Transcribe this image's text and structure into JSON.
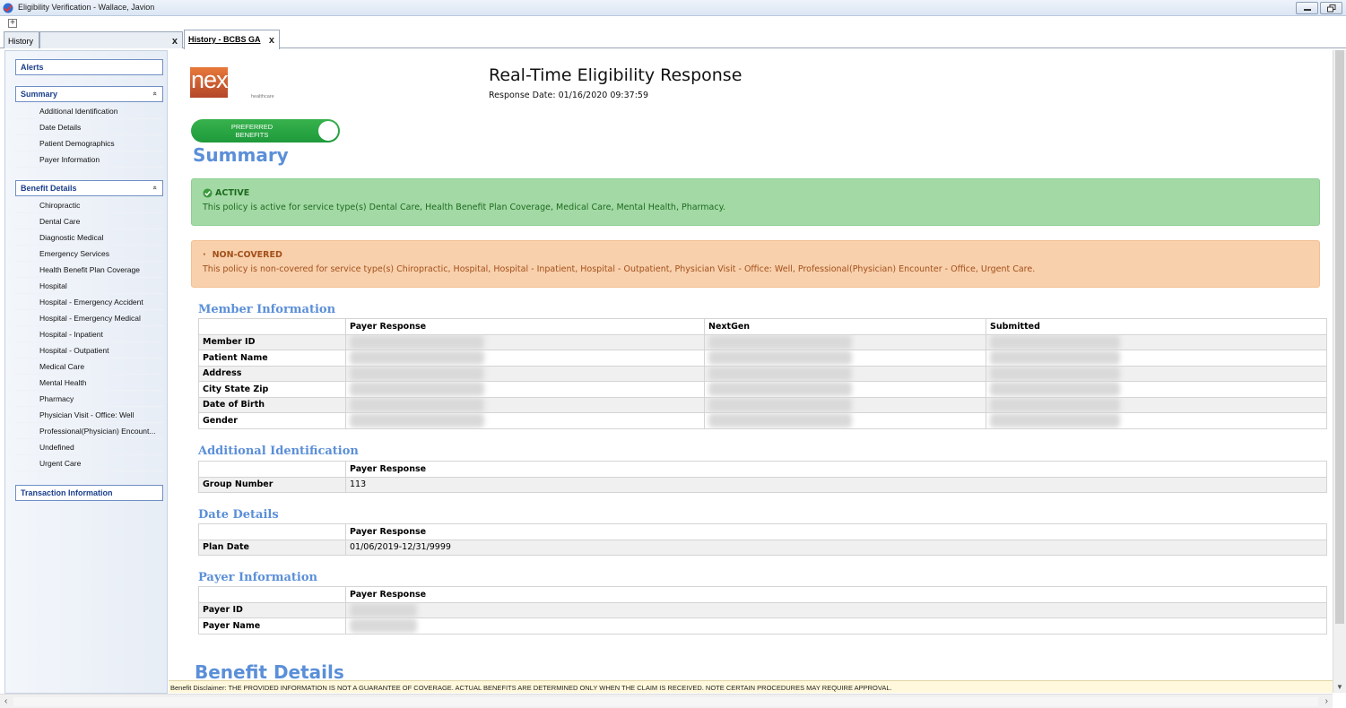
{
  "window": {
    "title": "Eligibility Verification - Wallace, Javion"
  },
  "tabs": [
    {
      "label": "History"
    },
    {
      "label": ""
    },
    {
      "label": "History - BCBS GA"
    }
  ],
  "tab_close": "x",
  "sidebar": {
    "alerts": "Alerts",
    "summary": {
      "label": "Summary",
      "items": [
        "Additional Identification",
        "Date Details",
        "Patient Demographics",
        "Payer Information"
      ]
    },
    "benefit_details": {
      "label": "Benefit Details",
      "items": [
        "Chiropractic",
        "Dental Care",
        "Diagnostic Medical",
        "Emergency Services",
        "Health Benefit Plan Coverage",
        "Hospital",
        "Hospital - Emergency Accident",
        "Hospital - Emergency Medical",
        "Hospital - Inpatient",
        "Hospital - Outpatient",
        "Medical Care",
        "Mental Health",
        "Pharmacy",
        "Physician Visit - Office: Well",
        "Professional(Physician) Encount...",
        "Undefined",
        "Urgent Care"
      ]
    },
    "transaction": "Transaction Information",
    "chevron": "«"
  },
  "header": {
    "logo_text": "nextgen",
    "logo_sub": "healthcare",
    "title": "Real-Time Eligibility Response",
    "response_date": "Response Date: 01/16/2020  09:37:59",
    "toggle_label_1": "PREFERRED",
    "toggle_label_2": "BENEFITS"
  },
  "summary": {
    "heading": "Summary",
    "active_label": "ACTIVE",
    "active_text": "This policy is active for service type(s) Dental Care, Health Benefit Plan Coverage, Medical Care, Mental Health, Pharmacy.",
    "noncovered_label": "NON-COVERED",
    "noncovered_text": "This policy is non-covered for service type(s) Chiropractic, Hospital, Hospital - Inpatient, Hospital - Outpatient, Physician Visit - Office: Well, Professional(Physician) Encounter - Office, Urgent Care."
  },
  "member_information": {
    "title": "Member Information",
    "columns": [
      "Payer Response",
      "NextGen",
      "Submitted"
    ],
    "rows": [
      "Member ID",
      "Patient Name",
      "Address",
      "City State Zip",
      "Date of Birth",
      "Gender"
    ]
  },
  "additional_identification": {
    "title": "Additional Identification",
    "column": "Payer Response",
    "row_label": "Group Number",
    "row_value": "113"
  },
  "date_details": {
    "title": "Date Details",
    "column": "Payer Response",
    "row_label": "Plan Date",
    "row_value": "01/06/2019-12/31/9999"
  },
  "payer_information": {
    "title": "Payer Information",
    "column": "Payer Response",
    "rows": [
      "Payer ID",
      "Payer Name"
    ]
  },
  "benefit_details_heading": "Benefit Details",
  "disclaimer": "Benefit Disclaimer: THE PROVIDED INFORMATION IS NOT A GUARANTEE OF COVERAGE.  ACTUAL BENEFITS ARE DETERMINED ONLY WHEN THE CLAIM IS RECEIVED. NOTE CERTAIN PROCEDURES MAY REQUIRE APPROVAL.",
  "colors": {
    "accent_blue": "#5b8fd8",
    "active_green": "#a3d9a5",
    "noncovered_orange": "#f8d0ac"
  }
}
